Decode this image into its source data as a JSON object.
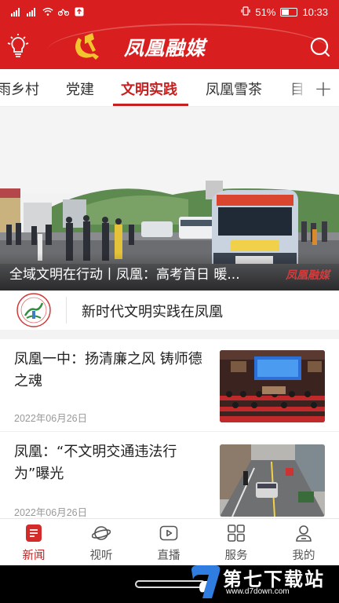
{
  "status_bar": {
    "battery_percent": "51%",
    "time": "10:33",
    "battery_level": 0.51
  },
  "app": {
    "title": "凤凰融媒"
  },
  "tabs": [
    {
      "label": "雨乡村",
      "active": false
    },
    {
      "label": "党建",
      "active": false
    },
    {
      "label": "文明实践",
      "active": true
    },
    {
      "label": "凤凰雪茶",
      "active": false
    },
    {
      "label": "目",
      "active": false
    }
  ],
  "tab_add_label": "+",
  "banner": {
    "caption": "全域文明在行动丨凤凰：高考首日 暖...",
    "watermark": "凤凰融媒"
  },
  "channel": {
    "title": "新时代文明实践在凤凰"
  },
  "news": [
    {
      "title": "凤凰一中：扬清廉之风 铸师德之魂",
      "date": "2022年06月26日"
    },
    {
      "title": "凤凰：“不文明交通违法行为”曝光",
      "date": "2022年06月26日"
    }
  ],
  "bottom_nav": [
    {
      "label": "新闻",
      "icon": "news-icon",
      "active": true
    },
    {
      "label": "视听",
      "icon": "planet-icon",
      "active": false
    },
    {
      "label": "直播",
      "icon": "play-icon",
      "active": false
    },
    {
      "label": "服务",
      "icon": "grid-icon",
      "active": false
    },
    {
      "label": "我的",
      "icon": "user-icon",
      "active": false
    }
  ],
  "site_watermark": {
    "main": "第七下载站",
    "sub": "www.d7down.com"
  },
  "colors": {
    "brand_red": "#d81e1e",
    "active_red": "#c62020"
  }
}
